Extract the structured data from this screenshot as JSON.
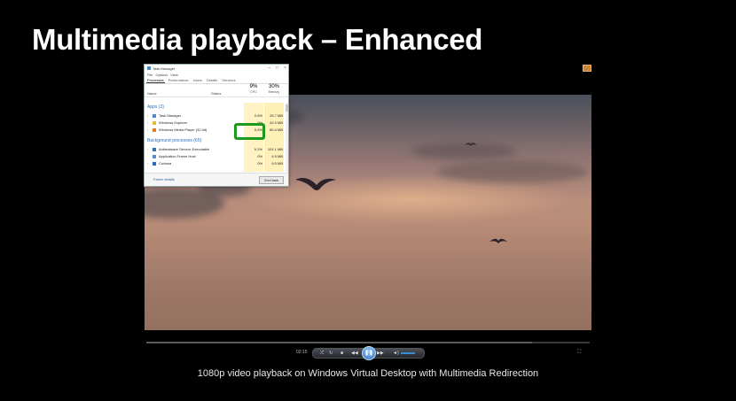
{
  "slide": {
    "title": "Multimedia playback – Enhanced",
    "caption": "1080p video playback on Windows Virtual Desktop with Multimedia Redirection"
  },
  "task_manager": {
    "window_title": "Task Manager",
    "menu": [
      "File",
      "Options",
      "View"
    ],
    "tabs": [
      "Processes",
      "Performance",
      "Users",
      "Details",
      "Services"
    ],
    "active_tab": "Processes",
    "columns": {
      "name": "Name",
      "status": "Status",
      "cpu_pct": "9%",
      "cpu_label": "CPU",
      "mem_pct": "30%",
      "mem_label": "Memory"
    },
    "apps_group": "Apps (3)",
    "apps": [
      {
        "name": "Task Manager",
        "cpu": "0.6%",
        "mem": "26.7 MB"
      },
      {
        "name": "Windows Explorer",
        "cpu": "0%",
        "mem": "42.0 MB"
      },
      {
        "name": "Windows Media Player (32 bit)",
        "cpu": "5.5%",
        "mem": "80.4 MB"
      }
    ],
    "bg_group": "Background processes (65)",
    "background": [
      {
        "name": "Antimalware Service Executable",
        "cpu": "0.2%",
        "mem": "101.1 MB"
      },
      {
        "name": "Application Frame Host",
        "cpu": "0%",
        "mem": "4.9 MB"
      },
      {
        "name": "Cortana",
        "cpu": "0%",
        "mem": "9.5 MB"
      }
    ],
    "fewer_details": "Fewer details",
    "end_task": "End task"
  },
  "player": {
    "time": "02:15",
    "progress": 0.87
  },
  "colors": {
    "highlight": "#1d9a1d",
    "accent": "#2c6fb8"
  },
  "icons": [
    "app-icon",
    "minimize-icon",
    "maximize-icon",
    "close-icon",
    "shuffle-icon",
    "repeat-icon",
    "stop-icon",
    "previous-icon",
    "play-pause-icon",
    "next-icon",
    "mute-icon",
    "fullscreen-icon"
  ]
}
